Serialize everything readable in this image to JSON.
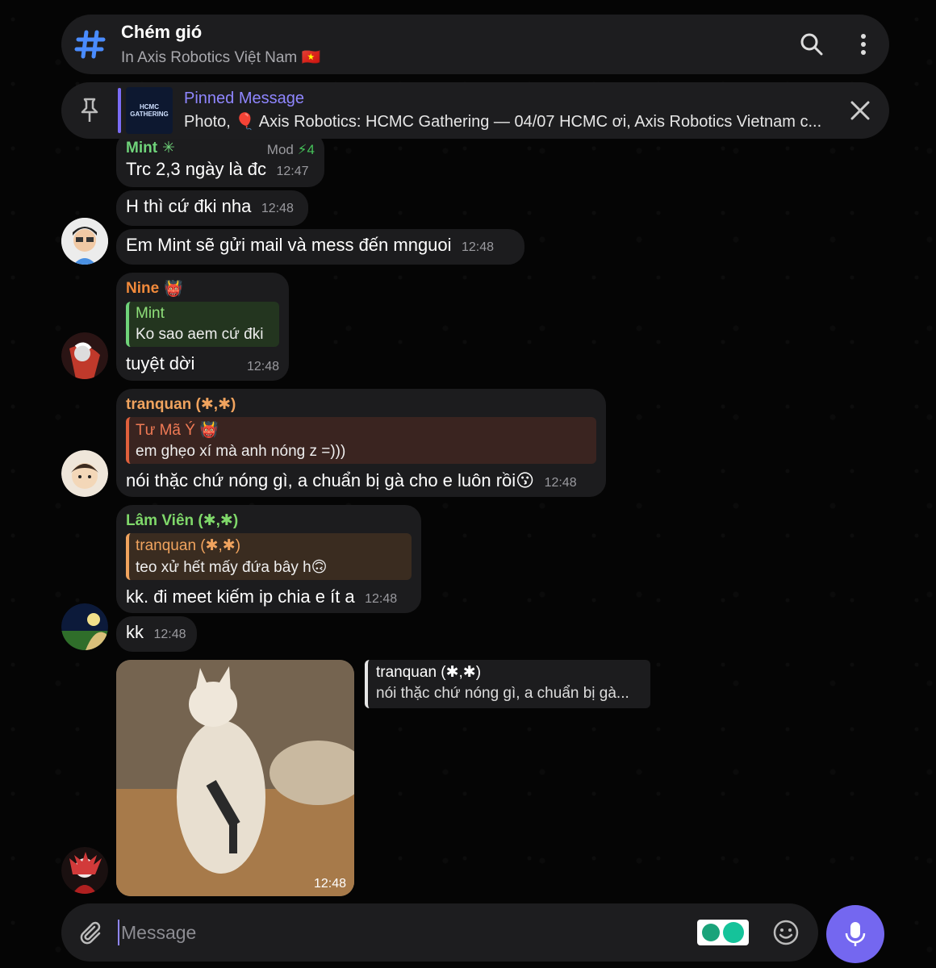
{
  "header": {
    "title": "Chém gió",
    "subtitle": "In Axis Robotics Việt Nam 🇻🇳"
  },
  "pinned": {
    "label": "Pinned Message",
    "preview": "Photo, 🎈 Axis Robotics: HCMC Gathering — 04/07 HCMC ơi, Axis Robotics Vietnam c...",
    "thumb_line1": "HCMC",
    "thumb_line2": "GATHERING"
  },
  "messages": {
    "m1": {
      "sender": "Mint",
      "sender_color": "#6fd37a",
      "badge": "Mod",
      "boost": "4",
      "text": "Trc 2,3 ngày là đc",
      "time": "12:47"
    },
    "m2": {
      "text": "H thì cứ đki nha",
      "time": "12:48"
    },
    "m3": {
      "text": "Em Mint sẽ gửi mail và mess đến mnguoi",
      "time": "12:48"
    },
    "m4": {
      "sender": "Nine",
      "sender_color": "#f28a3b",
      "reply_name": "Mint",
      "reply_text": "Ko sao aem cứ đki",
      "text": "tuyệt dời",
      "time": "12:48"
    },
    "m5": {
      "sender": "tranquan (✱,✱)",
      "sender_color": "#f0a35e",
      "reply_name": "Tư Mã Ý",
      "reply_text": "em ghẹo xí mà anh nóng z =)))",
      "text": "nói thặc chứ nóng gì, a chuẩn bị gà cho e luôn rồi😗",
      "time": "12:48"
    },
    "m6": {
      "sender": "Lâm Viên (✱,✱)",
      "sender_color": "#7fd86a",
      "reply_name": "tranquan (✱,✱)",
      "reply_text": "teo xử hết mấy đứa bây h🙃",
      "text": "kk. đi meet kiếm ip chia e ít a",
      "time": "12:48"
    },
    "m7": {
      "text": "kk",
      "time": "12:48"
    },
    "m8": {
      "time": "12:48",
      "fwd_name": "tranquan (✱,✱)",
      "fwd_text": "nói thặc chứ nóng gì, a chuẩn bị gà..."
    }
  },
  "input": {
    "placeholder": "Message"
  },
  "colors": {
    "accent": "#7467f0",
    "bubble": "#1c1c1e",
    "panel": "#1d1d1f"
  }
}
